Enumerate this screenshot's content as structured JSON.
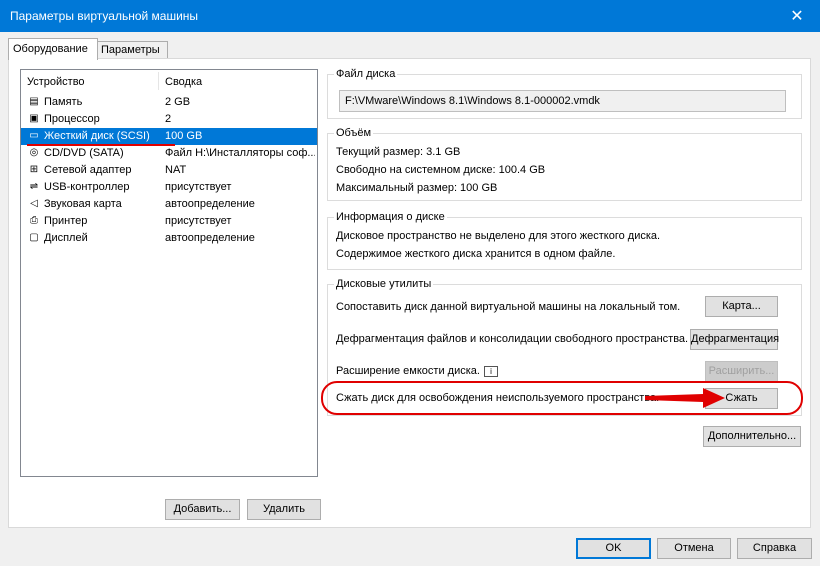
{
  "window": {
    "title": "Параметры виртуальной машины",
    "close_glyph": "✕"
  },
  "tabs": [
    {
      "label": "Оборудование"
    },
    {
      "label": "Параметры"
    }
  ],
  "device_list": {
    "col_device": "Устройство",
    "col_summary": "Сводка",
    "rows": [
      {
        "icon": "memory-icon",
        "glyph": "▤",
        "name": "Память",
        "summary": "2 GB"
      },
      {
        "icon": "processor-icon",
        "glyph": "▣",
        "name": "Процессор",
        "summary": "2"
      },
      {
        "icon": "harddisk-icon",
        "glyph": "▭",
        "name": "Жесткий диск (SCSI)",
        "summary": "100 GB",
        "selected": true
      },
      {
        "icon": "cd-dvd-icon",
        "glyph": "◎",
        "name": "CD/DVD (SATA)",
        "summary": "Файл H:\\Инсталляторы соф..."
      },
      {
        "icon": "network-icon",
        "glyph": "⊞",
        "name": "Сетевой адаптер",
        "summary": "NAT"
      },
      {
        "icon": "usb-icon",
        "glyph": "⇌",
        "name": "USB-контроллер",
        "summary": "присутствует"
      },
      {
        "icon": "sound-icon",
        "glyph": "◁",
        "name": "Звуковая карта",
        "summary": "автоопределение"
      },
      {
        "icon": "printer-icon",
        "glyph": "⎙",
        "name": "Принтер",
        "summary": "присутствует"
      },
      {
        "icon": "display-icon",
        "glyph": "▢",
        "name": "Дисплей",
        "summary": "автоопределение"
      }
    ],
    "add_button": "Добавить...",
    "remove_button": "Удалить"
  },
  "disk_file": {
    "legend": "Файл диска",
    "path": "F:\\VMware\\Windows 8.1\\Windows 8.1-000002.vmdk"
  },
  "capacity": {
    "legend": "Объём",
    "current": "Текущий размер: 3.1 GB",
    "free": "Свободно на системном диске: 100.4 GB",
    "max": "Максимальный размер: 100 GB"
  },
  "disk_info": {
    "legend": "Информация о диске",
    "line1": "Дисковое пространство не выделено для этого жесткого диска.",
    "line2": "Содержимое жесткого диска хранится в одном файле."
  },
  "utilities": {
    "legend": "Дисковые утилиты",
    "map_text": "Сопоставить диск данной виртуальной машины на локальный том.",
    "map_button": "Карта...",
    "defrag_text": "Дефрагментация файлов и консолидации свободного пространства.",
    "defrag_button": "Дефрагментация",
    "expand_text": "Расширение емкости диска.",
    "expand_button": "Расширить...",
    "compact_text": "Сжать диск для освобождения неиспользуемого пространства.",
    "compact_button": "Сжать"
  },
  "advanced_button": "Дополнительно...",
  "footer": {
    "ok": "OK",
    "cancel": "Отмена",
    "help": "Справка"
  },
  "colors": {
    "accent": "#0078d7",
    "annotation_red": "#e00000"
  }
}
